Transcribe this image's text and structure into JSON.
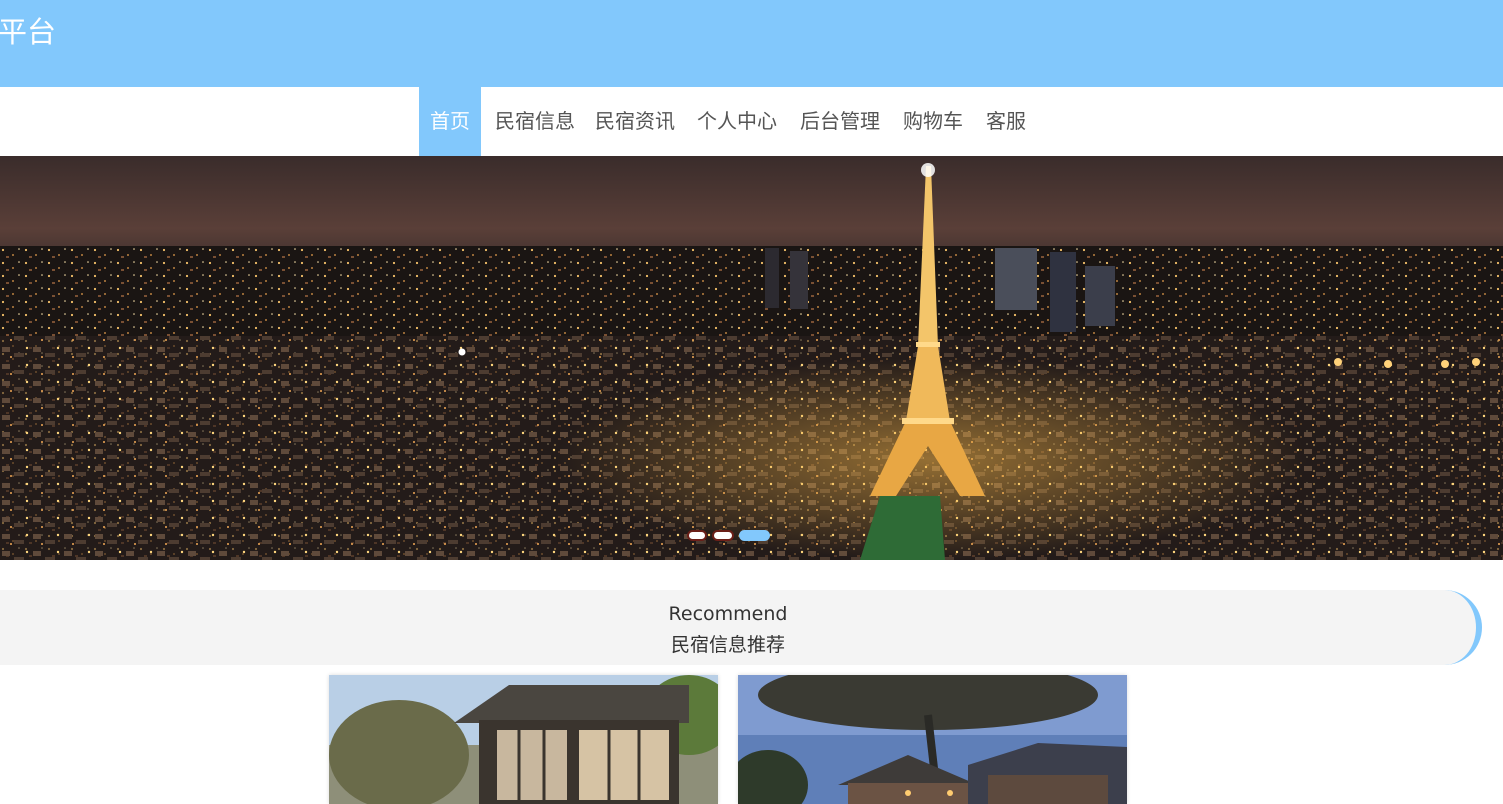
{
  "header": {
    "title": "平台"
  },
  "nav": {
    "items": [
      {
        "label": "首页",
        "active": true
      },
      {
        "label": "民宿信息",
        "active": false
      },
      {
        "label": "民宿资讯",
        "active": false
      },
      {
        "label": "个人中心",
        "active": false
      },
      {
        "label": "后台管理",
        "active": false
      },
      {
        "label": "购物车",
        "active": false
      },
      {
        "label": "客服",
        "active": false
      }
    ]
  },
  "carousel": {
    "slide_count": 3,
    "active_index": 2,
    "colors": {
      "active": "#82c8fc",
      "inactive": "#ffffff"
    }
  },
  "recommend": {
    "title_en": "Recommend",
    "title_zh": "民宿信息推荐"
  },
  "theme": {
    "accent": "#82c8fc",
    "nav_text": "#555555",
    "section_bg": "#f4f4f4"
  }
}
